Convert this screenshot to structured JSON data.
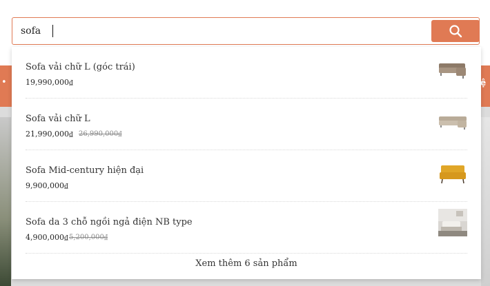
{
  "search": {
    "value": "sofa",
    "button_icon": "search-icon"
  },
  "background": {
    "nav_right_text": "ệ",
    "nav_left_glyph": "•"
  },
  "suggestions": [
    {
      "name": "Sofa vải chữ L (góc trái)",
      "price": "19,990,000₫",
      "old_price": "",
      "thumb": "gray-l-sofa"
    },
    {
      "name": "Sofa vải chữ L",
      "price": "21,990,000₫",
      "old_price": "26,990,000₫",
      "thumb": "beige-l-sofa"
    },
    {
      "name": "Sofa Mid-century hiện đại",
      "price": "9,900,000₫",
      "old_price": "",
      "thumb": "yellow-sofa"
    },
    {
      "name": "Sofa da 3 chỗ ngồi ngả điện NB type",
      "price": "4,900,000₫",
      "old_price": "5,200,000₫",
      "thumb": "room-photo"
    }
  ],
  "more_link": "Xem thêm 6 sản phẩm",
  "colors": {
    "accent": "#e07a54"
  }
}
